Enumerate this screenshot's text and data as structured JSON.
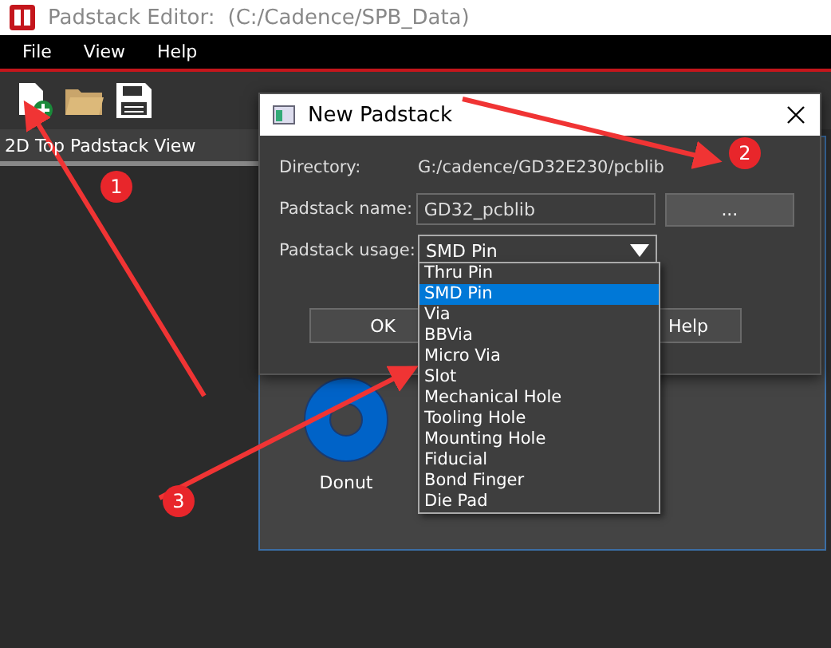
{
  "window": {
    "title": "Padstack Editor:",
    "path": "(C:/Cadence/SPB_Data)"
  },
  "menu": [
    "File",
    "View",
    "Help"
  ],
  "panel": {
    "title": "2D Top Padstack View"
  },
  "dialog": {
    "title": "New Padstack",
    "directory_label": "Directory:",
    "directory": "G:/cadence/GD32E230/pcblib",
    "name_label": "Padstack name:",
    "name": "GD32_pcblib",
    "browse": "...",
    "usage_label": "Padstack usage:",
    "usage": "SMD Pin",
    "options": [
      {
        "label": "Thru Pin",
        "selected": false
      },
      {
        "label": "SMD Pin",
        "selected": true
      },
      {
        "label": "Via",
        "selected": false
      },
      {
        "label": "BBVia",
        "selected": false
      },
      {
        "label": "Micro Via",
        "selected": false
      },
      {
        "label": "Slot",
        "selected": false
      },
      {
        "label": "Mechanical Hole",
        "selected": false
      },
      {
        "label": "Tooling Hole",
        "selected": false
      },
      {
        "label": "Mounting Hole",
        "selected": false
      },
      {
        "label": "Fiducial",
        "selected": false
      },
      {
        "label": "Bond Finger",
        "selected": false
      },
      {
        "label": "Die Pad",
        "selected": false
      }
    ],
    "buttons": [
      "OK",
      "Help"
    ]
  },
  "shape": {
    "label": "Donut"
  },
  "annotations": [
    "1",
    "2",
    "3"
  ]
}
